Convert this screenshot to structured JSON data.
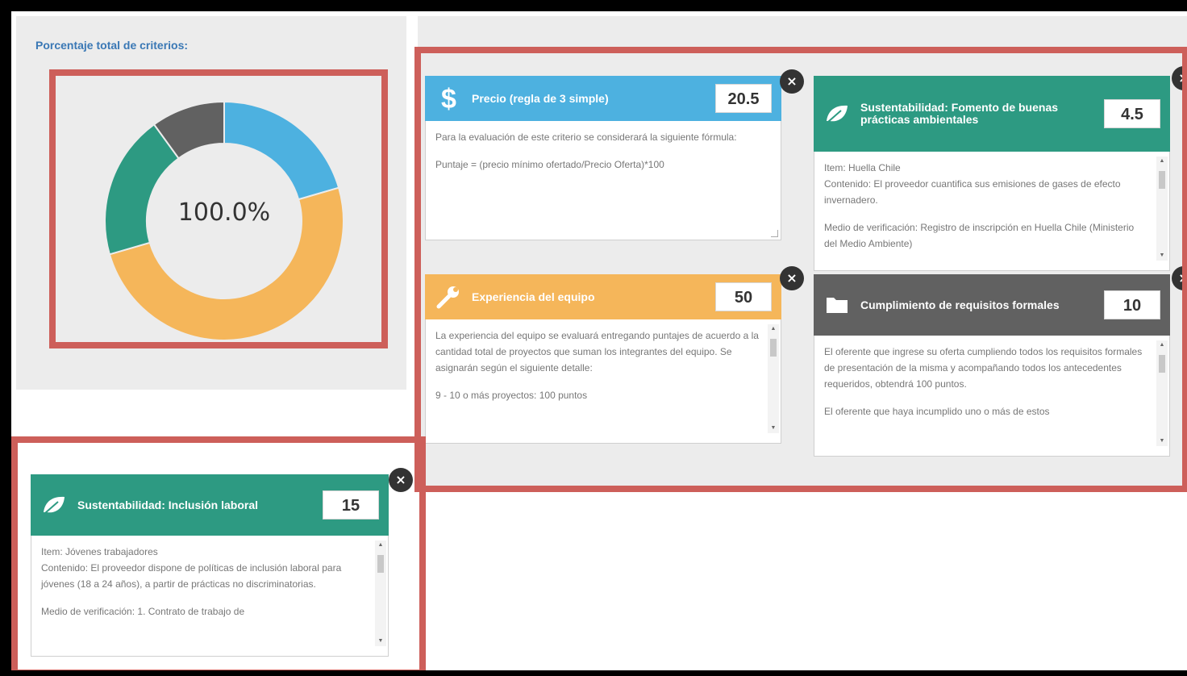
{
  "section_title": "Porcentaje total de criterios:",
  "donut": {
    "label": "100.0%",
    "segments": [
      {
        "name": "Precio (regla de 3 simple)",
        "value": 20.5,
        "color": "#4db1e0"
      },
      {
        "name": "Experiencia del equipo",
        "value": 50,
        "color": "#f5b65a"
      },
      {
        "name": "Sustentabilidad: Fomento de buenas prácticas ambientales / Inclusión laboral",
        "value": 19.5,
        "color": "#2d9a82"
      },
      {
        "name": "Cumplimiento de requisitos formales",
        "value": 10,
        "color": "#616161"
      }
    ]
  },
  "cards": {
    "precio": {
      "icon": "dollar-icon",
      "title": "Precio (regla de 3 simple)",
      "value": "20.5",
      "color": "#4db1e0",
      "lines": [
        "Para la evaluación de este criterio se considerará la siguiente fórmula:",
        "",
        "Puntaje = (precio mínimo ofertado/Precio Oferta)*100"
      ]
    },
    "ambiental": {
      "icon": "leaf-icon",
      "title": "Sustentabilidad: Fomento de buenas prácticas ambientales",
      "value": "4.5",
      "color": "#2d9a82",
      "lines": [
        "Item: Huella Chile",
        "Contenido: El proveedor cuantifica sus emisiones de gases de efecto invernadero.",
        "",
        "Medio de verificación: Registro de inscripción en Huella Chile (Ministerio del Medio Ambiente)"
      ]
    },
    "experiencia": {
      "icon": "wrench-icon",
      "title": "Experiencia del equipo",
      "value": "50",
      "color": "#f5b65a",
      "lines": [
        "La experiencia del equipo se evaluará entregando puntajes de acuerdo a la cantidad total de proyectos que suman los integrantes del equipo. Se asignarán según el siguiente detalle:",
        "",
        "9 - 10 o más proyectos: 100 puntos"
      ]
    },
    "requisitos": {
      "icon": "folder-icon",
      "title": "Cumplimiento de requisitos formales",
      "value": "10",
      "color": "#616161",
      "lines": [
        "El oferente que ingrese su oferta cumpliendo todos los requisitos formales de presentación de la misma y acompañando todos los antecedentes requeridos, obtendrá 100 puntos.",
        "",
        "El oferente que haya incumplido uno o más de estos"
      ]
    },
    "inclusion": {
      "icon": "leaf-icon",
      "title": "Sustentabilidad: Inclusión laboral",
      "value": "15",
      "color": "#2d9a82",
      "lines": [
        "Item: Jóvenes trabajadores",
        "Contenido: El proveedor dispone de políticas de inclusión laboral para jóvenes (18 a 24 años), a partir de prácticas no discriminatorias.",
        "",
        "Medio de verificación: 1. Contrato de trabajo de"
      ]
    }
  },
  "close_label": "×"
}
